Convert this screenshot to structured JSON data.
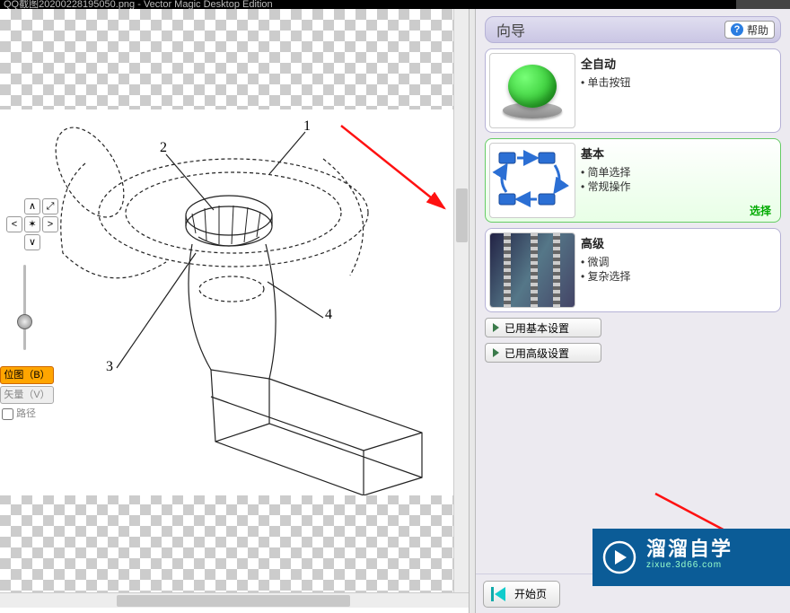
{
  "window": {
    "title_fragment": "QQ截图20200228195050.png - Vector Magic Desktop Edition"
  },
  "canvas": {
    "callouts": [
      "1",
      "2",
      "3",
      "4"
    ],
    "mode_bitmap": "位图（B）",
    "mode_vector": "矢量（V）",
    "path_checkbox": "路径"
  },
  "nav": {
    "up": "∧",
    "down": "∨",
    "left": "<",
    "right": ">",
    "center": "✶",
    "fit": "⤢"
  },
  "wizard": {
    "header": "向导",
    "help": "帮助",
    "selected_label": "选择",
    "options": {
      "auto": {
        "title": "全自动",
        "b1": "单击按钮"
      },
      "basic": {
        "title": "基本",
        "b1": "简单选择",
        "b2": "常规操作"
      },
      "advanced": {
        "title": "高级",
        "b1": "微调",
        "b2": "复杂选择"
      }
    },
    "btn_basic_settings": "已用基本设置",
    "btn_adv_settings": "已用高级设置",
    "start_page": "开始页"
  },
  "watermark": {
    "big": "溜溜自学",
    "small": "zixue.3d66.com"
  }
}
